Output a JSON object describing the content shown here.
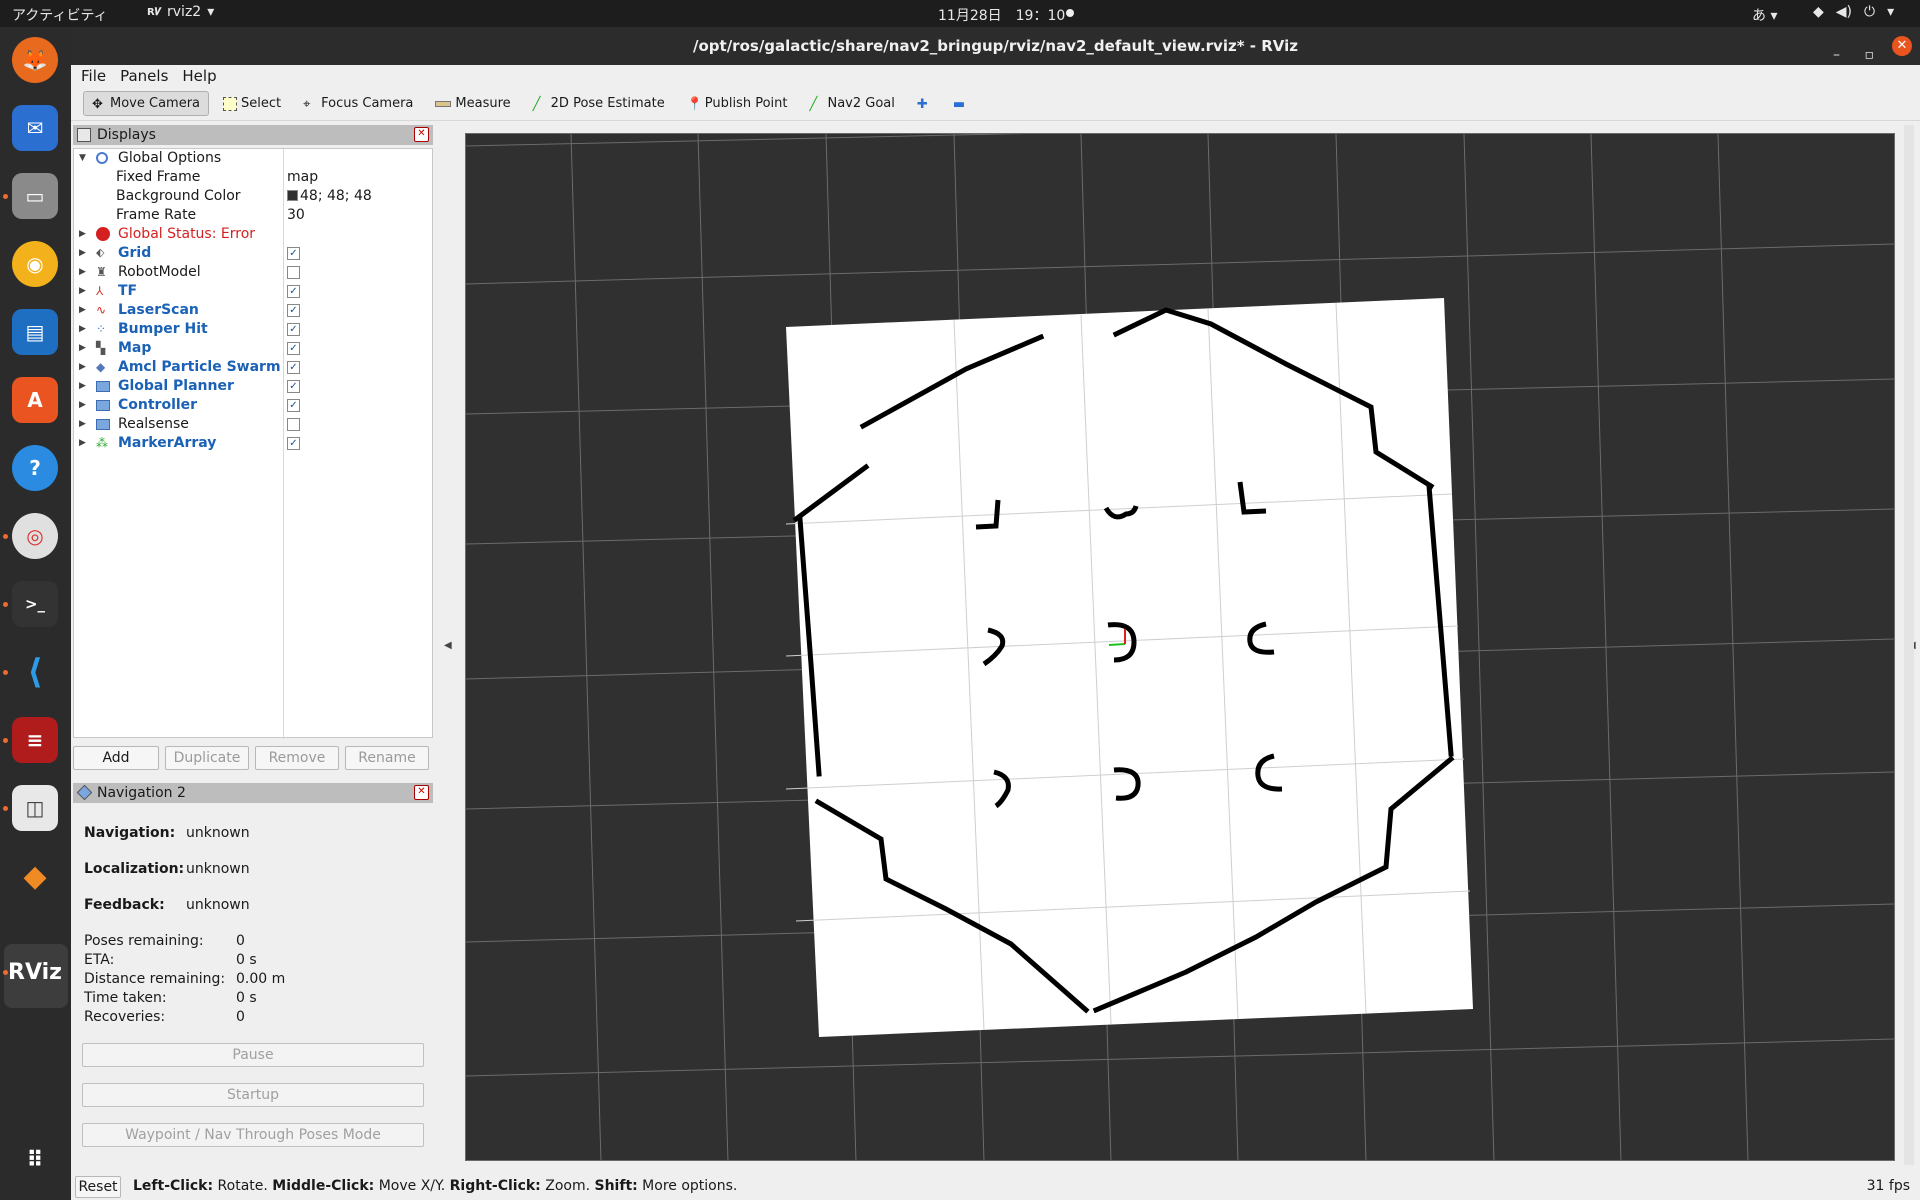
{
  "topbar": {
    "activities": "アクティビティ",
    "app_name": "rviz2",
    "clock": "11月28日　19：10",
    "ime": "あ"
  },
  "window": {
    "title": "/opt/ros/galactic/share/nav2_bringup/rviz/nav2_default_view.rviz* - RViz"
  },
  "menu": {
    "file": "File",
    "panels": "Panels",
    "help": "Help"
  },
  "toolbar": {
    "move_camera": "Move Camera",
    "select": "Select",
    "focus_camera": "Focus Camera",
    "measure": "Measure",
    "pose_estimate": "2D Pose Estimate",
    "publish_point": "Publish Point",
    "nav2_goal": "Nav2 Goal"
  },
  "displays": {
    "title": "Displays",
    "global_options": "Global Options",
    "fixed_frame_label": "Fixed Frame",
    "fixed_frame_value": "map",
    "bg_color_label": "Background Color",
    "bg_color_value": "48; 48; 48",
    "frame_rate_label": "Frame Rate",
    "frame_rate_value": "30",
    "global_status": "Global Status: Error",
    "items": [
      {
        "label": "Grid",
        "checked": true,
        "enabled": true
      },
      {
        "label": "RobotModel",
        "checked": false,
        "enabled": false
      },
      {
        "label": "TF",
        "checked": true,
        "enabled": true
      },
      {
        "label": "LaserScan",
        "checked": true,
        "enabled": true
      },
      {
        "label": "Bumper Hit",
        "checked": true,
        "enabled": true
      },
      {
        "label": "Map",
        "checked": true,
        "enabled": true
      },
      {
        "label": "Amcl Particle Swarm",
        "checked": true,
        "enabled": true
      },
      {
        "label": "Global Planner",
        "checked": true,
        "enabled": true
      },
      {
        "label": "Controller",
        "checked": true,
        "enabled": true
      },
      {
        "label": "Realsense",
        "checked": false,
        "enabled": false
      },
      {
        "label": "MarkerArray",
        "checked": true,
        "enabled": true
      }
    ],
    "buttons": {
      "add": "Add",
      "duplicate": "Duplicate",
      "remove": "Remove",
      "rename": "Rename"
    }
  },
  "nav2": {
    "title": "Navigation 2",
    "navigation_label": "Navigation:",
    "navigation_value": "unknown",
    "localization_label": "Localization:",
    "localization_value": "unknown",
    "feedback_label": "Feedback:",
    "feedback_value": "unknown",
    "poses_label": "Poses remaining:",
    "poses_value": "0",
    "eta_label": "ETA:",
    "eta_value": "0 s",
    "distance_label": "Distance remaining:",
    "distance_value": "0.00 m",
    "time_label": "Time taken:",
    "time_value": "0 s",
    "recoveries_label": "Recoveries:",
    "recoveries_value": "0",
    "pause": "Pause",
    "startup": "Startup",
    "waypoint_mode": "Waypoint / Nav Through Poses Mode"
  },
  "status": {
    "reset": "Reset",
    "left_key": "Left-Click:",
    "left_text": " Rotate. ",
    "middle_key": "Middle-Click:",
    "middle_text": " Move X/Y. ",
    "right_key": "Right-Click:",
    "right_text": " Zoom. ",
    "shift_key": "Shift:",
    "shift_text": " More options.",
    "fps": "31 fps"
  },
  "colors": {
    "background": "#303030",
    "accent_blue": "#1b62b6",
    "error_red": "#d42020"
  }
}
